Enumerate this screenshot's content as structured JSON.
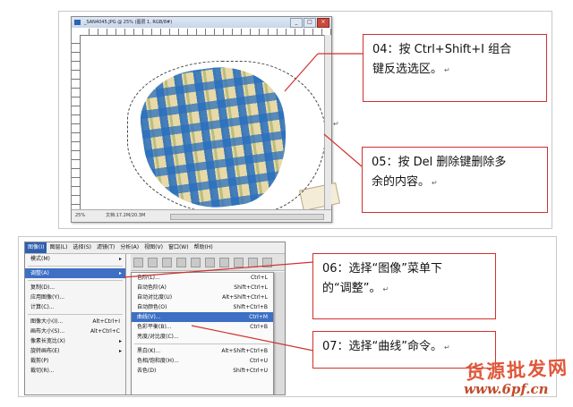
{
  "top_window": {
    "title": "_SAN4045.JPG @ 25% (图层 1, RGB/8#)",
    "zoom": "25%",
    "doc_info": "文档:17.2M/20.3M"
  },
  "menu_window": {
    "menubar": [
      "图像(I)",
      "图层(L)",
      "选择(S)",
      "滤镜(T)",
      "分析(A)",
      "视图(V)",
      "窗口(W)",
      "帮助(H)"
    ],
    "left_menu": [
      {
        "label": "模式(M)",
        "shortcut": "",
        "arrow": true
      },
      {
        "label": "调整(A)",
        "shortcut": "",
        "arrow": true,
        "highlight": true
      },
      {
        "label": "复制(D)...",
        "shortcut": ""
      },
      {
        "label": "应用图像(Y)...",
        "shortcut": ""
      },
      {
        "label": "计算(C)...",
        "shortcut": ""
      },
      {
        "label": "图像大小(I)...",
        "shortcut": "Alt+Ctrl+I"
      },
      {
        "label": "画布大小(S)...",
        "shortcut": "Alt+Ctrl+C"
      },
      {
        "label": "像素长宽比(X)",
        "shortcut": "",
        "arrow": true
      },
      {
        "label": "旋转画布(E)",
        "shortcut": "",
        "arrow": true
      },
      {
        "label": "裁剪(P)",
        "shortcut": ""
      },
      {
        "label": "裁切(R)...",
        "shortcut": ""
      }
    ],
    "sub_menu": [
      {
        "label": "色阶(L)...",
        "shortcut": "Ctrl+L"
      },
      {
        "label": "自动色阶(A)",
        "shortcut": "Shift+Ctrl+L"
      },
      {
        "label": "自动对比度(U)",
        "shortcut": "Alt+Shift+Ctrl+L"
      },
      {
        "label": "自动颜色(O)",
        "shortcut": "Shift+Ctrl+B"
      },
      {
        "label": "曲线(V)...",
        "shortcut": "Ctrl+M",
        "highlight": true
      },
      {
        "label": "色彩平衡(B)...",
        "shortcut": "Ctrl+B"
      },
      {
        "label": "亮度/对比度(C)...",
        "shortcut": ""
      },
      {
        "label": "黑白(K)...",
        "shortcut": "Alt+Shift+Ctrl+B"
      },
      {
        "label": "色相/饱和度(H)...",
        "shortcut": "Ctrl+U"
      },
      {
        "label": "去色(D)",
        "shortcut": "Shift+Ctrl+U"
      }
    ]
  },
  "annotations": {
    "step04": {
      "line1": "04：按 Ctrl+Shift+I 组合",
      "line2": "键反选选区。"
    },
    "step05": {
      "line1": "05：按 Del 删除键删除多",
      "line2": "余的内容。"
    },
    "step06": {
      "line1": "06：选择“图像”菜单下",
      "line2": "的“调整”。"
    },
    "step07": {
      "line1": "07：选择“曲线”命令。"
    }
  },
  "return_mark": "↵",
  "watermark": {
    "text": "货源批发网",
    "url": "www.6pf.cn"
  },
  "colors": {
    "annotation_border": "#d0312d",
    "menu_highlight": "#3d6fc4",
    "watermark": "#e0583a"
  }
}
